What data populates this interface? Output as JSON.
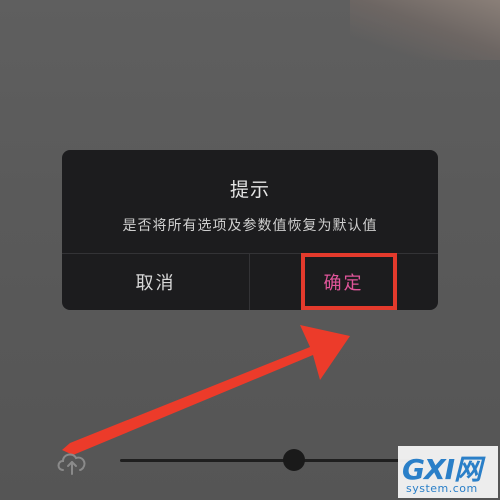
{
  "dialog": {
    "title": "提示",
    "message": "是否将所有选项及参数值恢复为默认值",
    "cancel_label": "取消",
    "confirm_label": "确定"
  },
  "slider": {
    "value_fraction": 0.6
  },
  "watermark": {
    "logo": "GXI网",
    "site": "system.com"
  },
  "icons": {
    "upload": "cloud-upload-icon",
    "annotation_arrow": "red-arrow-icon"
  },
  "colors": {
    "confirm_text": "#e0559a",
    "highlight": "#e33a2c",
    "dialog_bg": "#1c1c1e"
  }
}
